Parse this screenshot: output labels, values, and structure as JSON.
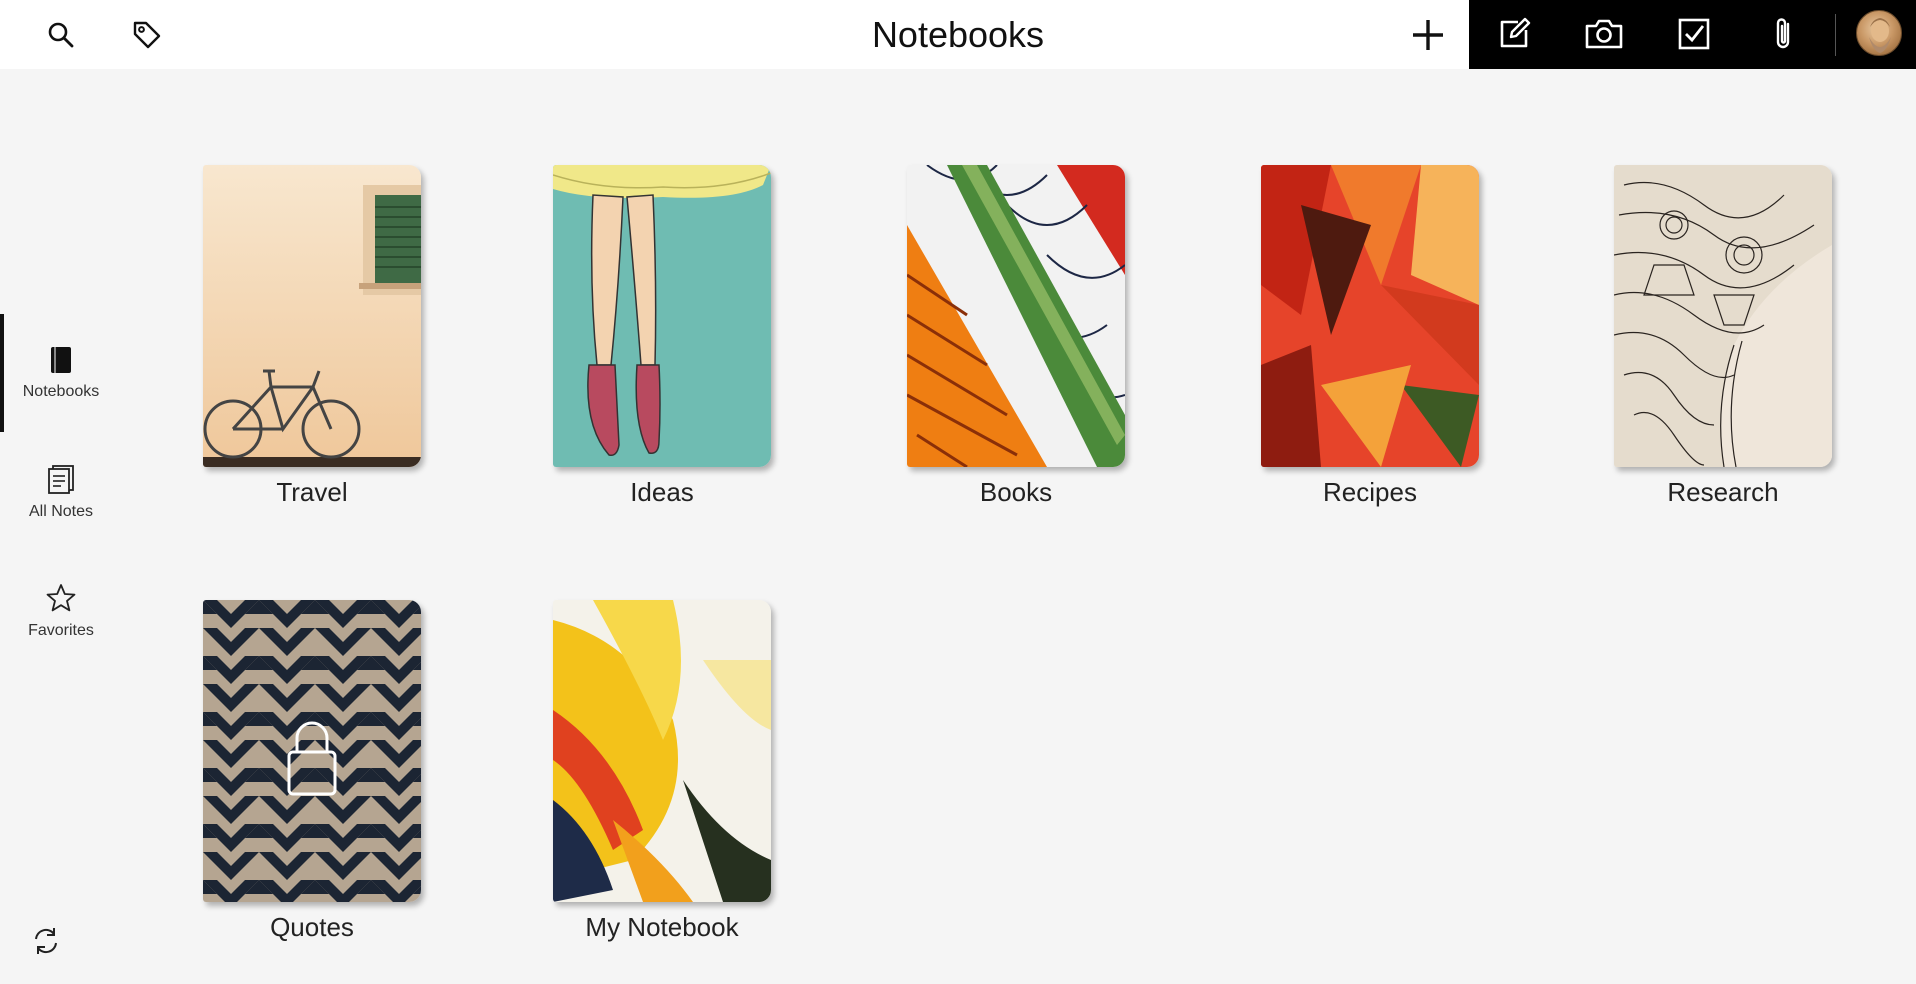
{
  "header": {
    "title": "Notebooks"
  },
  "sidebar": {
    "items": [
      {
        "label": "Notebooks",
        "icon": "notebook-icon",
        "active": true
      },
      {
        "label": "All Notes",
        "icon": "notes-stack-icon",
        "active": false
      },
      {
        "label": "Favorites",
        "icon": "star-icon",
        "active": false
      }
    ],
    "sync_icon": "sync-icon"
  },
  "toolbar": {
    "left_icons": [
      "search-icon",
      "tag-icon"
    ],
    "add_icon": "plus-icon",
    "tools": [
      "new-note-icon",
      "camera-icon",
      "checklist-icon",
      "attachment-icon"
    ],
    "avatar": "avatar"
  },
  "notebooks": [
    {
      "name": "Travel",
      "locked": false
    },
    {
      "name": "Ideas",
      "locked": false
    },
    {
      "name": "Books",
      "locked": false
    },
    {
      "name": "Recipes",
      "locked": false
    },
    {
      "name": "Research",
      "locked": false
    },
    {
      "name": "Quotes",
      "locked": true
    },
    {
      "name": "My Notebook",
      "locked": false
    }
  ],
  "colors": {
    "background": "#f5f5f5",
    "topbar": "#ffffff",
    "toolbar_dark": "#000000",
    "text": "#222222"
  }
}
